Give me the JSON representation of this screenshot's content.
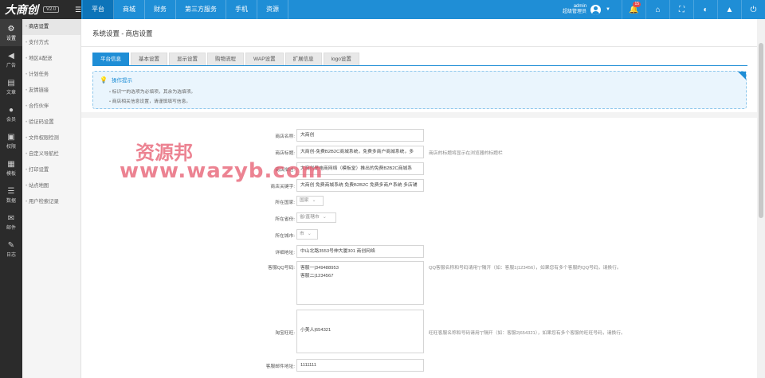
{
  "header": {
    "logo": "大商创",
    "version": "V2.0",
    "nav": [
      "平台",
      "商城",
      "财务",
      "第三方服务",
      "手机",
      "资源"
    ],
    "user_name": "admin",
    "user_role": "超级管理员",
    "notification_count": "15"
  },
  "iconbar": [
    {
      "icon": "gear-icon",
      "label": "设置"
    },
    {
      "icon": "megaphone-icon",
      "label": "广告"
    },
    {
      "icon": "article-icon",
      "label": "文章"
    },
    {
      "icon": "member-icon",
      "label": "会员"
    },
    {
      "icon": "lock-icon",
      "label": "权限"
    },
    {
      "icon": "template-icon",
      "label": "模板"
    },
    {
      "icon": "database-icon",
      "label": "数据"
    },
    {
      "icon": "mail-icon",
      "label": "邮件"
    },
    {
      "icon": "log-icon",
      "label": "日志"
    }
  ],
  "submenu": [
    "商店设置",
    "支付方式",
    "地区&配送",
    "计划任务",
    "友情链接",
    "合作伙伴",
    "验证码设置",
    "文件权限检测",
    "自定义导航栏",
    "打印设置",
    "站点地图",
    "用户检索记录"
  ],
  "page": {
    "title": "系统设置 - 商店设置",
    "tabs": [
      "平台信息",
      "基本设置",
      "显示设置",
      "购物流程",
      "WAP设置",
      "扩展信息",
      "logo设置"
    ]
  },
  "tips": {
    "title": "操作提示",
    "items": [
      "标识“*”的选项为必填项，其余为选填项。",
      "商店相关信息设置，请谨慎填写信息。"
    ]
  },
  "form": {
    "shop_name": {
      "label": "商店名称:",
      "value": "大商创"
    },
    "shop_title": {
      "label": "商店标题:",
      "value": "大商创-免费B2B2C商城系统，免费多商户商城系统，多",
      "hint": "商店的标题将显示在浏览器的标题栏"
    },
    "shop_desc": {
      "label": "商店描述:",
      "value": "大商创是电商网络（模板堂）推出的免费B2B2C商城系"
    },
    "shop_keywords": {
      "label": "商店关键字:",
      "value": "大商创 免费商城系统 免费B2B2C 免费多商户系统  多店铺"
    },
    "country": {
      "label": "所在国家:",
      "value": "国家"
    },
    "province": {
      "label": "所在省份:",
      "value": "省/直辖市"
    },
    "city": {
      "label": "所在城市:",
      "value": "市"
    },
    "address": {
      "label": "详细地址:",
      "value": "中山北路3553号伸大厦301 商创网络"
    },
    "qq": {
      "label": "客服QQ号码:",
      "lines": [
        "客服一|349488953",
        "客服二|1234567"
      ],
      "hint": "QQ客服名称和号码请用“|”隔开（如：客服1|123456），如果您有多个客服的QQ号码，请换行。"
    },
    "wangwang": {
      "label": "淘宝旺旺:",
      "lines": [
        "小美人|654321"
      ],
      "hint": "旺旺客服名称和号码请用“|”隔开（如：客服2|654321），如果您有多个客服的旺旺号码，请换行。"
    },
    "email": {
      "label": "客服邮件地址:",
      "value": "1111111"
    }
  },
  "watermark": {
    "line1": "资源邦",
    "line2": "www.wazyb.com"
  }
}
